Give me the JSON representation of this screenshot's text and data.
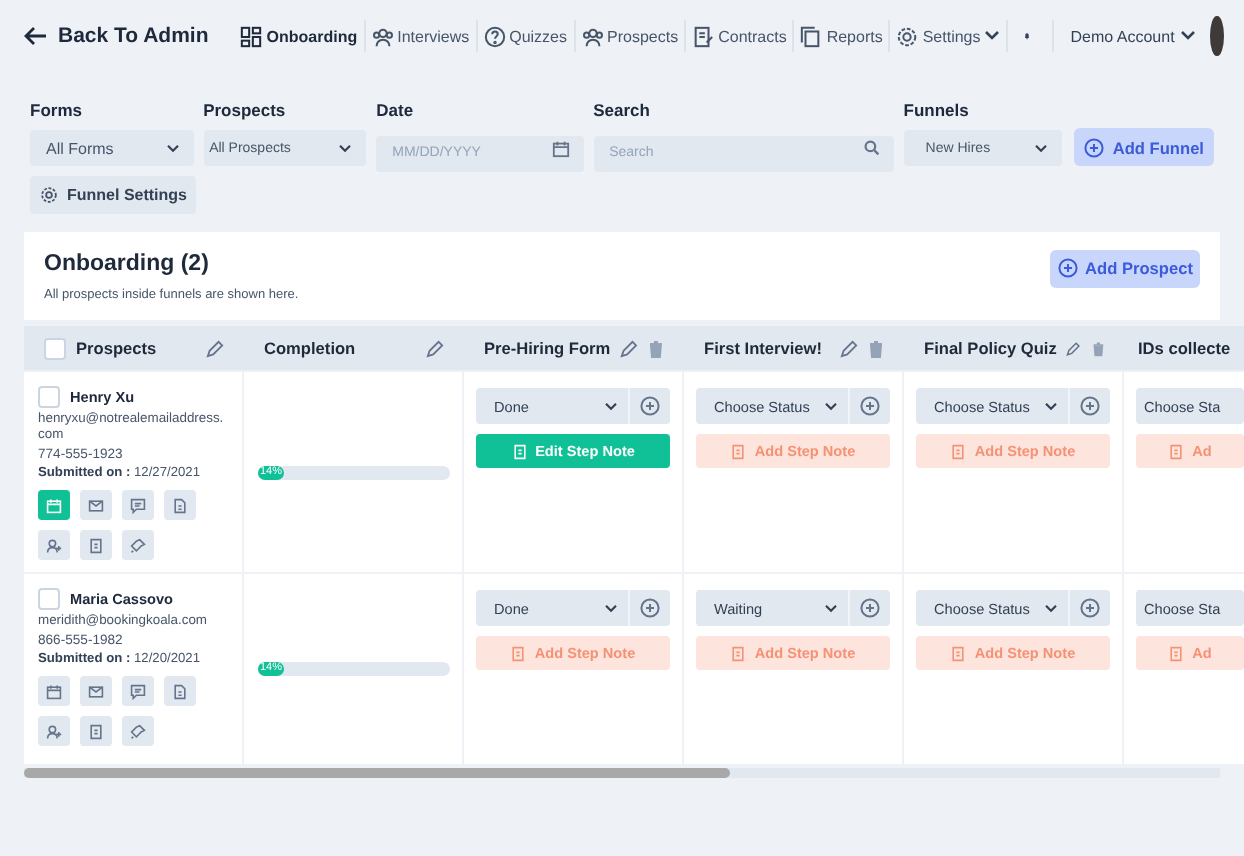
{
  "header": {
    "back": "Back To Admin",
    "nav": [
      {
        "label": "Onboarding",
        "selected": true
      },
      {
        "label": "Interviews",
        "selected": false
      },
      {
        "label": "Quizzes",
        "selected": false
      },
      {
        "label": "Prospects",
        "selected": false
      },
      {
        "label": "Contracts",
        "selected": false
      },
      {
        "label": "Reports",
        "selected": false
      },
      {
        "label": "Settings",
        "selected": false
      }
    ],
    "account": "Demo Account"
  },
  "filters": {
    "forms": {
      "label": "Forms",
      "value": "All Forms"
    },
    "prospects": {
      "label": "Prospects",
      "value": "All Prospects"
    },
    "date": {
      "label": "Date",
      "placeholder": "MM/DD/YYYY"
    },
    "search": {
      "label": "Search",
      "placeholder": "Search"
    },
    "funnels": {
      "label": "Funnels",
      "value": "New Hires"
    },
    "add_funnel": "Add Funnel",
    "funnel_settings": "Funnel Settings"
  },
  "funnel": {
    "title": "Onboarding (2)",
    "subtitle": "All prospects inside funnels are shown here.",
    "add_prospect": "Add Prospect"
  },
  "table": {
    "select_all_checked": false,
    "columns": [
      {
        "label": "Prospects",
        "kind": "check"
      },
      {
        "label": "Completion",
        "kind": "plain"
      },
      {
        "label": "Pre-Hiring Form",
        "kind": "step"
      },
      {
        "label": "First Interview!",
        "kind": "step"
      },
      {
        "label": "Final Policy Quiz",
        "kind": "step"
      },
      {
        "label": "IDs collecte",
        "kind": "cut"
      }
    ],
    "rows": [
      {
        "name": "Henry Xu",
        "checked": false,
        "email": "henryxu@notrealemailaddress.com",
        "phone": "774-555-1923",
        "submitted_label": "Submitted on :",
        "submitted": "12/27/2021",
        "actions": [
          {
            "selected": true
          },
          {
            "selected": false
          },
          {
            "selected": false
          },
          {
            "selected": false
          },
          {
            "selected": false
          },
          {
            "selected": false
          },
          {
            "selected": false
          }
        ],
        "completion": {
          "level": 0.14,
          "label": "14%"
        },
        "steps": [
          {
            "status": "Done",
            "note": "Edit Step Note",
            "kind": "edit"
          },
          {
            "status": "Choose Status",
            "note": "Add Step Note",
            "kind": "add"
          },
          {
            "status": "Choose Status",
            "note": "Add Step Note",
            "kind": "add"
          },
          {
            "status": "Choose Sta",
            "note": "Ad",
            "kind": "add"
          }
        ]
      },
      {
        "name": "Maria Cassovo",
        "checked": false,
        "email": "meridith@bookingkoala.com",
        "phone": "866-555-1982",
        "submitted_label": "Submitted on :",
        "submitted": "12/20/2021",
        "actions": [
          {
            "selected": false
          },
          {
            "selected": false
          },
          {
            "selected": false
          },
          {
            "selected": false
          },
          {
            "selected": false
          },
          {
            "selected": false
          },
          {
            "selected": false
          }
        ],
        "completion": {
          "level": 0.14,
          "label": "14%"
        },
        "steps": [
          {
            "status": "Done",
            "note": "Add Step Note",
            "kind": "add"
          },
          {
            "status": "Waiting",
            "note": "Add Step Note",
            "kind": "add"
          },
          {
            "status": "Choose Status",
            "note": "Add Step Note",
            "kind": "add"
          },
          {
            "status": "Choose Sta",
            "note": "Ad",
            "kind": "add"
          }
        ]
      }
    ]
  }
}
